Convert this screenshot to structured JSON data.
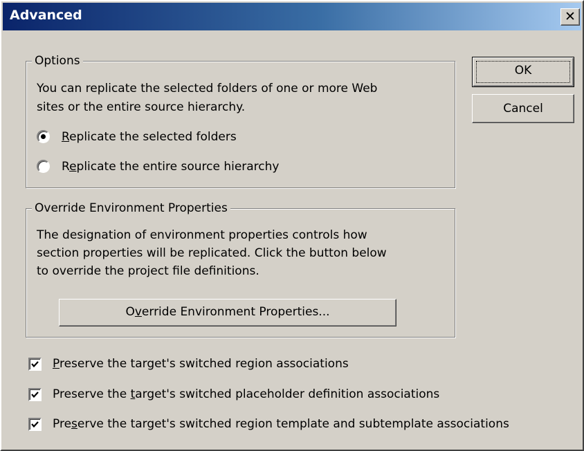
{
  "window": {
    "title": "Advanced",
    "close_glyph": "✕"
  },
  "options_group": {
    "title": "Options",
    "description_line1": "You can replicate the selected folders of one or more Web",
    "description_line2": "sites or the entire source hierarchy.",
    "radio_selected": {
      "mnemonic": "R",
      "rest": "eplicate the selected folders",
      "checked": true
    },
    "radio_entire": {
      "before": "R",
      "mnemonic": "e",
      "rest": "plicate the entire source hierarchy",
      "checked": false
    }
  },
  "override_group": {
    "title": "Override Environment Properties",
    "description_line1": "The designation of environment properties controls how",
    "description_line2": "section properties will be replicated.  Click the button below",
    "description_line3": "to override the project file definitions.",
    "button": {
      "before": "O",
      "mnemonic": "v",
      "rest": "erride Environment Properties..."
    }
  },
  "checkboxes": [
    {
      "before": "",
      "mnemonic": "P",
      "rest": "reserve the target's switched region associations",
      "checked": true
    },
    {
      "before": "Preserve the ",
      "mnemonic": "t",
      "rest": "arget's switched placeholder definition associations",
      "checked": true
    },
    {
      "before": "Pre",
      "mnemonic": "s",
      "rest": "erve the target's switched region template and subtemplate associations",
      "checked": true
    }
  ],
  "buttons": {
    "ok": "OK",
    "cancel": "Cancel"
  },
  "colors": {
    "dialog_bg": "#d4d0c8",
    "title_gradient_start": "#0a246a",
    "title_gradient_end": "#a6caf0"
  }
}
